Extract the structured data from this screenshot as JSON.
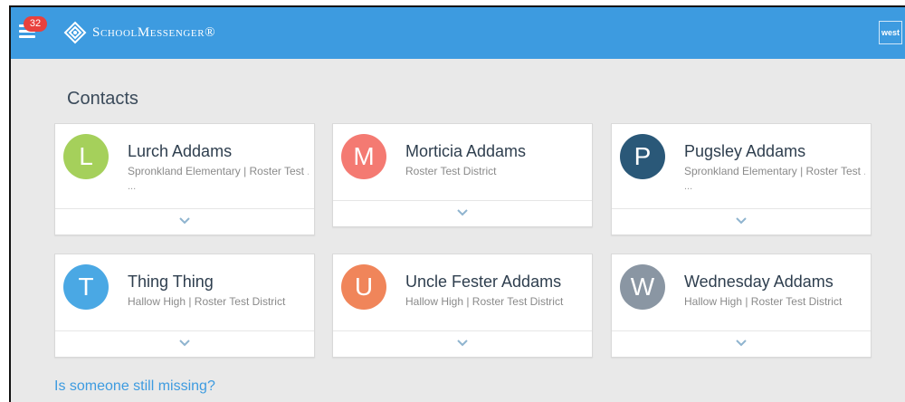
{
  "header": {
    "notification_count": "32",
    "brand": "SchoolMessenger®",
    "user_label": "west",
    "bar_color": "#3d9be0"
  },
  "page_title": "Contacts",
  "contacts": [
    {
      "initial": "L",
      "name": "Lurch Addams",
      "org": "Spronkland Elementary | Roster Test ...",
      "more": "...",
      "color": "#a5d05b"
    },
    {
      "initial": "M",
      "name": "Morticia Addams",
      "org": "Roster Test District",
      "more": "",
      "color": "#f47a72"
    },
    {
      "initial": "P",
      "name": "Pugsley Addams",
      "org": "Spronkland Elementary | Roster Test ...",
      "more": "...",
      "color": "#2a5878"
    },
    {
      "initial": "T",
      "name": "Thing Thing",
      "org": "Hallow High | Roster Test District",
      "more": "",
      "color": "#4aa8e4"
    },
    {
      "initial": "U",
      "name": "Uncle Fester Addams",
      "org": "Hallow High | Roster Test District",
      "more": "",
      "color": "#f0855a"
    },
    {
      "initial": "W",
      "name": "Wednesday Addams",
      "org": "Hallow High | Roster Test District",
      "more": "",
      "color": "#8a96a3"
    }
  ],
  "missing_link": "Is someone still missing?"
}
